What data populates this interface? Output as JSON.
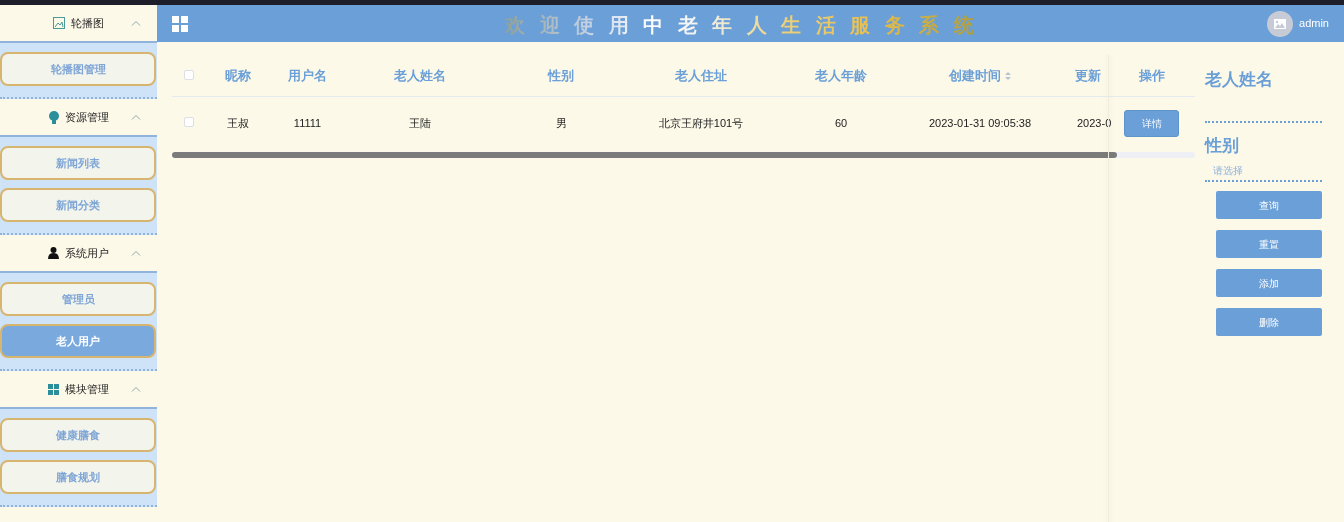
{
  "sidebar": {
    "groups": [
      {
        "label": "轮播图",
        "expanded": true,
        "items": [
          {
            "label": "轮播图管理",
            "selected": false
          }
        ]
      },
      {
        "label": "资源管理",
        "expanded": true,
        "items": [
          {
            "label": "新闻列表",
            "selected": false
          },
          {
            "label": "新闻分类",
            "selected": false
          }
        ]
      },
      {
        "label": "系统用户",
        "expanded": true,
        "items": [
          {
            "label": "管理员",
            "selected": false
          },
          {
            "label": "老人用户",
            "selected": true
          }
        ]
      },
      {
        "label": "模块管理",
        "expanded": true,
        "items": [
          {
            "label": "健康膳食",
            "selected": false
          },
          {
            "label": "膳食规划",
            "selected": false
          }
        ]
      }
    ]
  },
  "header": {
    "title": "欢迎使用中老年人生活服务系统",
    "user": "admin"
  },
  "table": {
    "select_all": {
      "checked": false
    },
    "columns": [
      {
        "label": "昵称",
        "sortable": false
      },
      {
        "label": "用户名",
        "sortable": false
      },
      {
        "label": "老人姓名",
        "sortable": false
      },
      {
        "label": "性别",
        "sortable": false
      },
      {
        "label": "老人住址",
        "sortable": false
      },
      {
        "label": "老人年龄",
        "sortable": false
      },
      {
        "label": "创建时间",
        "sortable": true
      },
      {
        "label": "更新",
        "sortable": false
      },
      {
        "label": "操作",
        "sortable": false
      }
    ],
    "rows": [
      {
        "checked": false,
        "cells": [
          "王叔",
          "11111",
          "王陆",
          "男",
          "北京王府井101号",
          "60",
          "2023-01-31 09:05:38",
          "2023-0"
        ],
        "action": "详情"
      }
    ]
  },
  "filters": {
    "fields": [
      {
        "label": "老人姓名",
        "kind": "text"
      },
      {
        "label": "性别",
        "kind": "select",
        "placeholder": "请选择"
      }
    ],
    "buttons": [
      "查询",
      "重置",
      "添加",
      "删除"
    ]
  }
}
